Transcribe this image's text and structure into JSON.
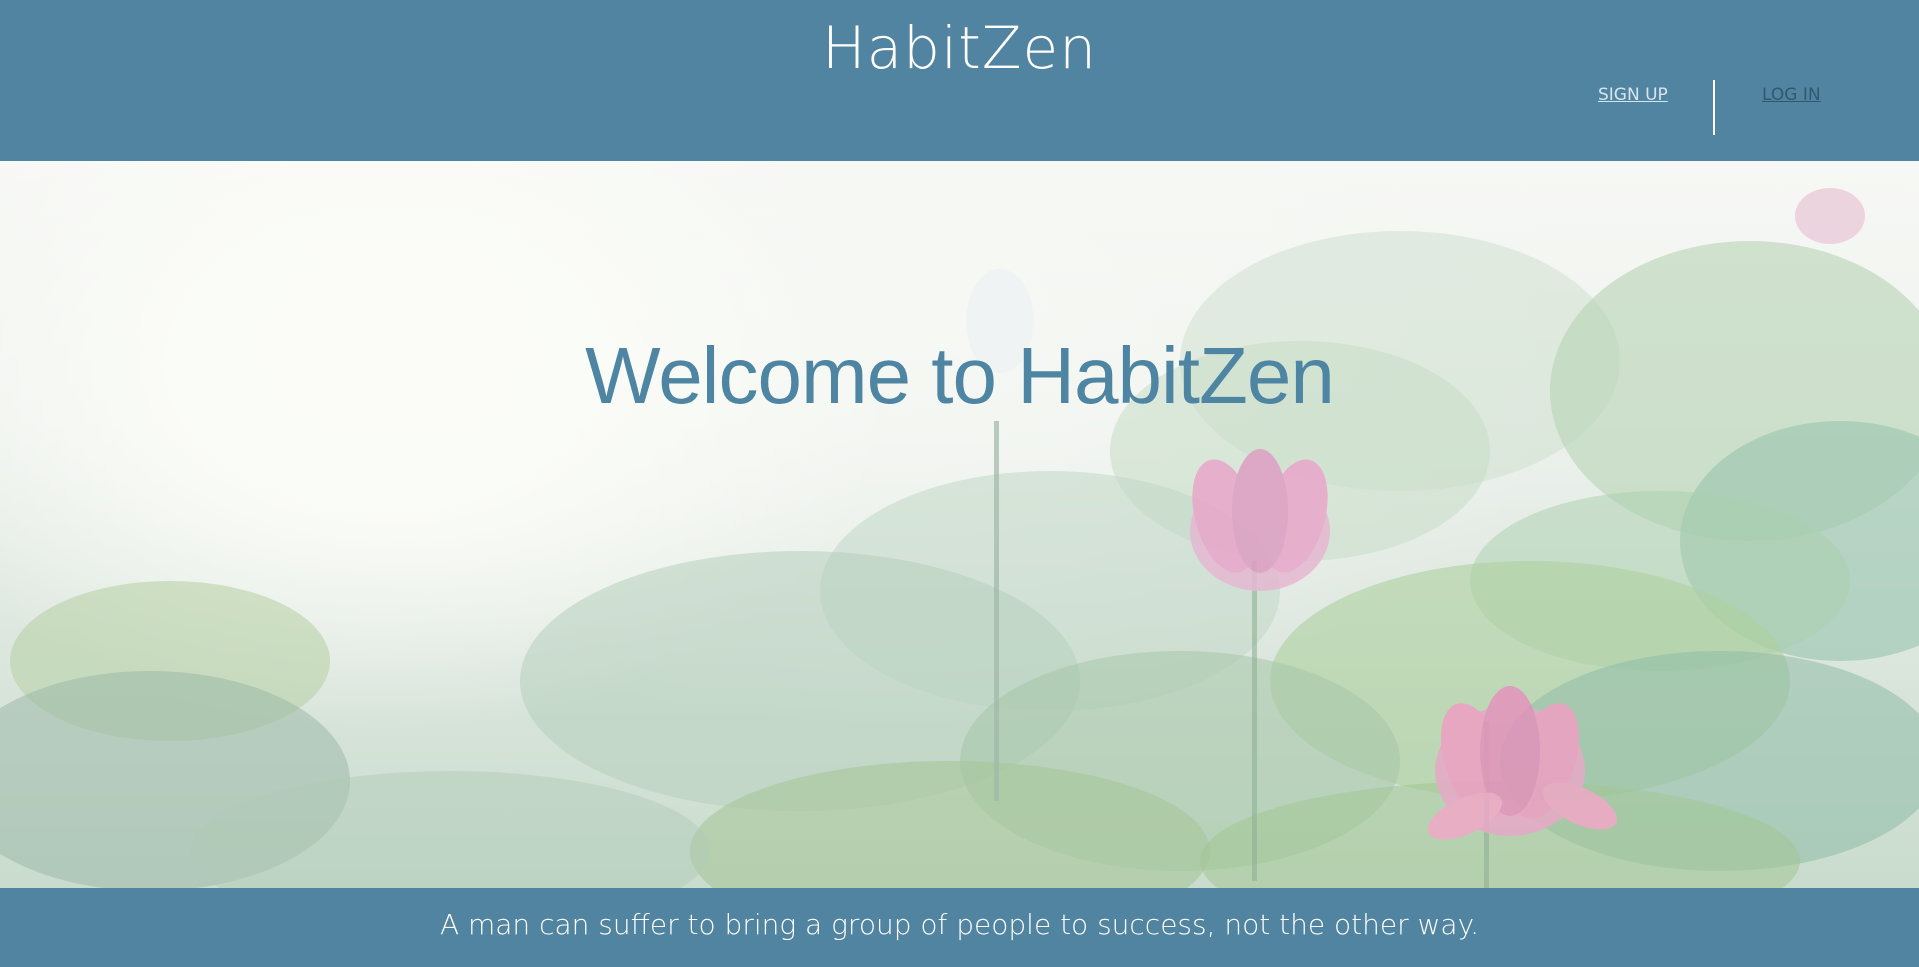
{
  "header": {
    "brand": "HabitZen",
    "nav": {
      "signup_label": "SIGN UP",
      "login_label": "LOG IN"
    }
  },
  "hero": {
    "title": "Welcome to HabitZen",
    "background_image": "lotus-pond-mist"
  },
  "footer": {
    "quote": "A man can suffer to bring a group of people to success, not the other way."
  },
  "colors": {
    "brand_blue": "#5184a1",
    "title_blue": "#4e85a3",
    "signup_link": "#d6e6ef",
    "login_link": "#33586e"
  }
}
